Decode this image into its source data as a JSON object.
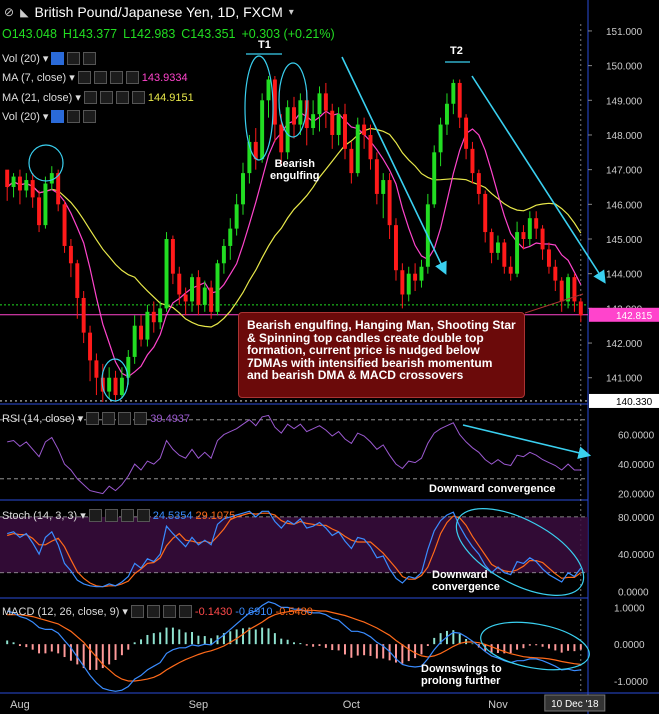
{
  "header": {
    "symbol": "British Pound/Japanese Yen, 1D, FXCM",
    "open": "O143.048",
    "high": "H143.377",
    "low": "L142.983",
    "close": "C143.351",
    "change": "+0.303 (+0.21%)"
  },
  "indicator_labels": {
    "vol1": "Vol (20)",
    "ma7": "MA (7, close)",
    "ma7_value": "143.9334",
    "ma21": "MA (21, close)",
    "ma21_value": "144.9151",
    "vol2": "Vol (20)",
    "rsi": "RSI (14, close)",
    "rsi_value": "39.4937",
    "stoch": "Stoch (14, 3, 3)",
    "stoch_k": "24.5354",
    "stoch_d": "29.1075",
    "macd": "MACD (12, 26, close, 9)",
    "macd_hist": "-0.1430",
    "macd_line": "-0.6910",
    "macd_signal": "-0.5480"
  },
  "annotations": {
    "t1": "T1",
    "t2": "T2",
    "bearish_engulfing": [
      "Bearish",
      "engulfing"
    ],
    "callout": "Bearish engulfing, Hanging Man, Shooting Star & Spinning top candles create double top formation, current price is nudged below 7DMAs with intensified bearish momentum and bearish DMA & MACD crossovers",
    "rsi_note": "Downward convergence",
    "stoch_note": [
      "Downward",
      "convergence"
    ],
    "macd_note": [
      "Downswings to",
      "prolong further"
    ]
  },
  "colors": {
    "up": "#22dd22",
    "down": "#ff1a1a",
    "ma7": "#ff44cc",
    "ma21": "#e8e84a",
    "rsi": "#9b59d0",
    "stoch_k": "#3a8cff",
    "stoch_d": "#ff6a1a",
    "arrow": "#3ad0f0",
    "callout": "#6b0a0a"
  },
  "chart_data": {
    "type": "candlestick",
    "x_labels": [
      "Aug",
      "Sep",
      "Oct",
      "Nov"
    ],
    "cursor_label": "10 Dec '18",
    "price_axis": {
      "ticks": [
        "151.000",
        "150.000",
        "149.000",
        "148.000",
        "147.000",
        "146.000",
        "145.000",
        "144.000",
        "143.000",
        "142.000",
        "141.000",
        "140.000"
      ],
      "range": [
        140.3,
        151.2
      ],
      "current_label": "142.815",
      "current_value": 142.815,
      "low_label": "140.330",
      "low_value": 140.33,
      "dotted_level": 143.1
    },
    "candles": [
      [
        147.0,
        146.5,
        146.1,
        146.8
      ],
      [
        146.5,
        146.8,
        146.2,
        146.9
      ],
      [
        146.8,
        146.4,
        146.0,
        147.0
      ],
      [
        146.4,
        146.7,
        146.2,
        146.9
      ],
      [
        146.7,
        146.2,
        145.9,
        146.9
      ],
      [
        146.2,
        145.4,
        145.2,
        146.4
      ],
      [
        145.4,
        146.6,
        145.3,
        146.8
      ],
      [
        146.6,
        146.9,
        146.4,
        147.1
      ],
      [
        146.9,
        146.0,
        145.8,
        147.0
      ],
      [
        146.0,
        144.8,
        144.6,
        146.1
      ],
      [
        144.8,
        144.3,
        143.9,
        145.0
      ],
      [
        144.3,
        143.3,
        142.7,
        144.4
      ],
      [
        143.3,
        142.3,
        142.0,
        143.5
      ],
      [
        142.3,
        141.5,
        140.9,
        142.5
      ],
      [
        141.5,
        141.0,
        140.5,
        141.7
      ],
      [
        141.0,
        140.6,
        140.3,
        141.4
      ],
      [
        140.6,
        141.0,
        140.4,
        141.3
      ],
      [
        141.0,
        140.5,
        140.3,
        141.2
      ],
      [
        140.5,
        141.0,
        140.4,
        141.3
      ],
      [
        141.0,
        141.6,
        140.8,
        141.8
      ],
      [
        141.6,
        142.5,
        141.4,
        142.8
      ],
      [
        142.5,
        142.1,
        141.9,
        142.8
      ],
      [
        142.1,
        142.9,
        141.9,
        143.1
      ],
      [
        142.9,
        142.6,
        142.3,
        143.2
      ],
      [
        142.6,
        143.0,
        142.4,
        143.2
      ],
      [
        143.0,
        145.0,
        142.9,
        145.2
      ],
      [
        145.0,
        144.0,
        143.7,
        145.1
      ],
      [
        144.0,
        143.4,
        143.1,
        144.2
      ],
      [
        143.4,
        143.2,
        142.8,
        143.6
      ],
      [
        143.2,
        143.9,
        142.9,
        144.0
      ],
      [
        143.9,
        143.1,
        142.8,
        144.1
      ],
      [
        143.1,
        143.6,
        142.9,
        143.8
      ],
      [
        143.6,
        142.9,
        142.7,
        143.8
      ],
      [
        142.9,
        144.3,
        142.8,
        144.4
      ],
      [
        144.3,
        144.8,
        144.0,
        145.0
      ],
      [
        144.8,
        145.3,
        144.4,
        145.6
      ],
      [
        145.3,
        146.0,
        145.1,
        146.3
      ],
      [
        146.0,
        146.9,
        145.7,
        147.2
      ],
      [
        146.9,
        147.8,
        146.6,
        148.0
      ],
      [
        147.8,
        147.3,
        147.0,
        148.2
      ],
      [
        147.3,
        149.0,
        147.2,
        149.2
      ],
      [
        149.0,
        149.6,
        148.5,
        149.7
      ],
      [
        149.6,
        148.3,
        147.8,
        149.7
      ],
      [
        148.3,
        147.5,
        147.1,
        148.6
      ],
      [
        147.5,
        148.8,
        147.3,
        149.0
      ],
      [
        148.8,
        148.3,
        147.9,
        149.1
      ],
      [
        148.3,
        149.0,
        148.0,
        149.2
      ],
      [
        149.0,
        148.2,
        147.7,
        149.3
      ],
      [
        148.2,
        148.6,
        148.0,
        149.0
      ],
      [
        148.6,
        149.2,
        148.1,
        149.4
      ],
      [
        149.2,
        148.7,
        148.2,
        149.5
      ],
      [
        148.7,
        148.0,
        147.6,
        148.9
      ],
      [
        148.0,
        148.6,
        147.7,
        148.8
      ],
      [
        148.6,
        147.6,
        147.3,
        148.9
      ],
      [
        147.6,
        146.9,
        146.6,
        147.8
      ],
      [
        146.9,
        148.3,
        146.8,
        148.5
      ],
      [
        148.3,
        148.0,
        147.6,
        148.5
      ],
      [
        148.0,
        147.3,
        147.0,
        148.3
      ],
      [
        147.3,
        146.3,
        146.0,
        147.5
      ],
      [
        146.3,
        146.7,
        145.6,
        146.9
      ],
      [
        146.7,
        145.4,
        145.0,
        146.9
      ],
      [
        145.4,
        144.1,
        143.8,
        145.6
      ],
      [
        144.1,
        143.4,
        143.0,
        144.3
      ],
      [
        143.4,
        144.0,
        143.2,
        144.2
      ],
      [
        144.0,
        143.8,
        143.5,
        144.3
      ],
      [
        143.8,
        144.2,
        143.6,
        144.4
      ],
      [
        144.2,
        146.0,
        144.0,
        146.3
      ],
      [
        146.0,
        147.5,
        145.9,
        147.7
      ],
      [
        147.5,
        148.3,
        147.1,
        148.5
      ],
      [
        148.3,
        148.9,
        148.0,
        149.2
      ],
      [
        148.9,
        149.5,
        148.6,
        149.6
      ],
      [
        149.5,
        148.5,
        148.2,
        149.6
      ],
      [
        148.5,
        147.6,
        147.3,
        148.6
      ],
      [
        147.6,
        146.9,
        146.6,
        147.8
      ],
      [
        146.9,
        146.3,
        146.0,
        147.0
      ],
      [
        146.3,
        145.2,
        144.9,
        146.4
      ],
      [
        145.2,
        144.6,
        144.3,
        145.3
      ],
      [
        144.6,
        144.9,
        144.4,
        145.1
      ],
      [
        144.9,
        144.2,
        144.0,
        145.0
      ],
      [
        144.2,
        144.0,
        143.8,
        144.5
      ],
      [
        144.0,
        145.2,
        143.9,
        145.5
      ],
      [
        145.2,
        145.0,
        144.7,
        145.4
      ],
      [
        145.0,
        145.6,
        144.8,
        145.8
      ],
      [
        145.6,
        145.3,
        145.0,
        145.8
      ],
      [
        145.3,
        144.7,
        144.4,
        145.4
      ],
      [
        144.7,
        144.2,
        144.0,
        144.9
      ],
      [
        144.2,
        143.8,
        143.5,
        144.4
      ],
      [
        143.8,
        143.2,
        142.9,
        143.9
      ],
      [
        143.2,
        143.9,
        143.0,
        144.0
      ],
      [
        143.9,
        143.2,
        142.9,
        144.0
      ],
      [
        143.2,
        142.8,
        142.6,
        143.3
      ]
    ],
    "rsi_axis": {
      "ticks": [
        "60.0000",
        "40.0000",
        "20.0000"
      ],
      "range": [
        17,
        78
      ],
      "dashed_levels": [
        70,
        30
      ]
    },
    "rsi": [
      55,
      56,
      52,
      55,
      50,
      45,
      55,
      58,
      50,
      40,
      36,
      30,
      26,
      22,
      21,
      20,
      25,
      22,
      26,
      32,
      40,
      36,
      42,
      40,
      44,
      56,
      50,
      46,
      44,
      50,
      44,
      48,
      44,
      56,
      60,
      62,
      64,
      67,
      70,
      66,
      72,
      73,
      65,
      61,
      67,
      64,
      67,
      62,
      64,
      66,
      63,
      59,
      62,
      57,
      54,
      61,
      59,
      55,
      50,
      53,
      46,
      40,
      37,
      42,
      41,
      44,
      54,
      61,
      64,
      66,
      68,
      60,
      55,
      51,
      48,
      43,
      40,
      43,
      40,
      39,
      46,
      45,
      48,
      46,
      43,
      41,
      39,
      36,
      40,
      36,
      36
    ],
    "stoch_axis": {
      "ticks": [
        "80.0000",
        "40.0000",
        "0.0000"
      ],
      "range": [
        -5,
        96
      ],
      "band": [
        20,
        80
      ]
    },
    "stoch_k": [
      62,
      64,
      58,
      62,
      52,
      40,
      58,
      64,
      50,
      30,
      22,
      12,
      8,
      6,
      5,
      5,
      8,
      6,
      10,
      16,
      30,
      25,
      35,
      32,
      40,
      70,
      62,
      55,
      48,
      58,
      50,
      55,
      50,
      72,
      78,
      80,
      82,
      84,
      86,
      80,
      86,
      86,
      75,
      68,
      76,
      72,
      78,
      68,
      70,
      74,
      68,
      60,
      64,
      54,
      46,
      58,
      56,
      48,
      36,
      38,
      24,
      14,
      9,
      16,
      14,
      20,
      45,
      65,
      76,
      82,
      85,
      70,
      58,
      48,
      40,
      28,
      20,
      26,
      20,
      18,
      32,
      30,
      36,
      32,
      24,
      18,
      14,
      10,
      20,
      16,
      25
    ],
    "stoch_d": [
      60,
      62,
      61,
      61,
      57,
      50,
      50,
      54,
      57,
      48,
      34,
      21,
      14,
      9,
      6,
      5,
      6,
      6,
      8,
      11,
      19,
      24,
      30,
      31,
      36,
      49,
      57,
      62,
      55,
      54,
      52,
      54,
      52,
      59,
      67,
      77,
      80,
      82,
      84,
      83,
      84,
      84,
      82,
      76,
      73,
      72,
      75,
      73,
      72,
      71,
      71,
      67,
      64,
      59,
      55,
      53,
      53,
      53,
      47,
      41,
      33,
      25,
      16,
      13,
      13,
      17,
      26,
      43,
      62,
      74,
      81,
      79,
      71,
      59,
      49,
      39,
      29,
      25,
      22,
      21,
      23,
      27,
      33,
      33,
      31,
      25,
      19,
      14,
      15,
      15,
      20
    ],
    "macd_axis": {
      "ticks": [
        "1.0000",
        "0.0000",
        "-1.0000"
      ],
      "range": [
        -1.3,
        1.2
      ]
    },
    "macd_line": [
      0.9,
      0.85,
      0.75,
      0.7,
      0.6,
      0.45,
      0.4,
      0.4,
      0.3,
      0.1,
      -0.1,
      -0.35,
      -0.6,
      -0.85,
      -1.05,
      -1.2,
      -1.25,
      -1.28,
      -1.25,
      -1.15,
      -0.95,
      -0.85,
      -0.7,
      -0.6,
      -0.5,
      -0.25,
      -0.15,
      -0.1,
      -0.1,
      -0.02,
      -0.05,
      0.0,
      -0.02,
      0.12,
      0.25,
      0.4,
      0.55,
      0.7,
      0.85,
      0.9,
      1.05,
      1.15,
      1.1,
      1.0,
      1.0,
      0.95,
      0.95,
      0.88,
      0.85,
      0.85,
      0.8,
      0.7,
      0.65,
      0.5,
      0.35,
      0.35,
      0.3,
      0.2,
      0.05,
      -0.05,
      -0.2,
      -0.4,
      -0.55,
      -0.6,
      -0.62,
      -0.6,
      -0.4,
      -0.15,
      0.05,
      0.2,
      0.32,
      0.3,
      0.2,
      0.08,
      -0.05,
      -0.2,
      -0.32,
      -0.38,
      -0.45,
      -0.5,
      -0.45,
      -0.45,
      -0.4,
      -0.4,
      -0.45,
      -0.52,
      -0.6,
      -0.7,
      -0.68,
      -0.72,
      -0.7
    ],
    "macd_signal": [
      0.8,
      0.8,
      0.8,
      0.78,
      0.75,
      0.7,
      0.65,
      0.6,
      0.55,
      0.45,
      0.35,
      0.2,
      0.05,
      -0.15,
      -0.35,
      -0.55,
      -0.7,
      -0.85,
      -0.95,
      -1.0,
      -1.0,
      -0.98,
      -0.95,
      -0.9,
      -0.82,
      -0.7,
      -0.6,
      -0.5,
      -0.42,
      -0.35,
      -0.28,
      -0.22,
      -0.18,
      -0.12,
      -0.05,
      0.05,
      0.15,
      0.27,
      0.4,
      0.5,
      0.6,
      0.72,
      0.8,
      0.85,
      0.88,
      0.9,
      0.92,
      0.92,
      0.92,
      0.9,
      0.9,
      0.86,
      0.82,
      0.78,
      0.72,
      0.66,
      0.6,
      0.52,
      0.44,
      0.34,
      0.24,
      0.1,
      -0.02,
      -0.14,
      -0.24,
      -0.32,
      -0.35,
      -0.32,
      -0.25,
      -0.16,
      -0.06,
      0.02,
      0.06,
      0.06,
      0.04,
      -0.01,
      -0.07,
      -0.14,
      -0.2,
      -0.26,
      -0.3,
      -0.34,
      -0.36,
      -0.37,
      -0.38,
      -0.4,
      -0.43,
      -0.47,
      -0.5,
      -0.53,
      -0.55
    ]
  }
}
